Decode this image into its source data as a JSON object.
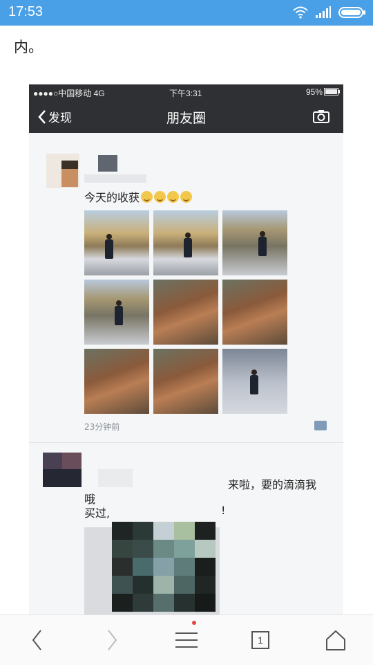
{
  "status_bar": {
    "time": "17:53",
    "background": "#4aa0e6"
  },
  "article": {
    "text": "内。"
  },
  "embedded_screenshot": {
    "ios_status": {
      "carrier": "●●●●○中国移动  4G",
      "time": "下午3:31",
      "battery": "95%"
    },
    "nav": {
      "back_label": "发现",
      "title": "朋友圈",
      "camera_icon": "camera-icon",
      "background": "#2f3033"
    },
    "post1": {
      "text": "今天的收获",
      "emoji_count": 4,
      "time": "23分钟前",
      "photo_count": 9
    },
    "post2": {
      "text_line1": "来啦，要的滴滴我",
      "text_line2": "哦",
      "text_line3": "买过,",
      "text_line4": "!"
    }
  },
  "toolbar": {
    "back_icon": "chevron-left-icon",
    "forward_icon": "chevron-right-icon",
    "menu_icon": "menu-icon",
    "tabs_count": "1",
    "home_icon": "home-icon"
  }
}
